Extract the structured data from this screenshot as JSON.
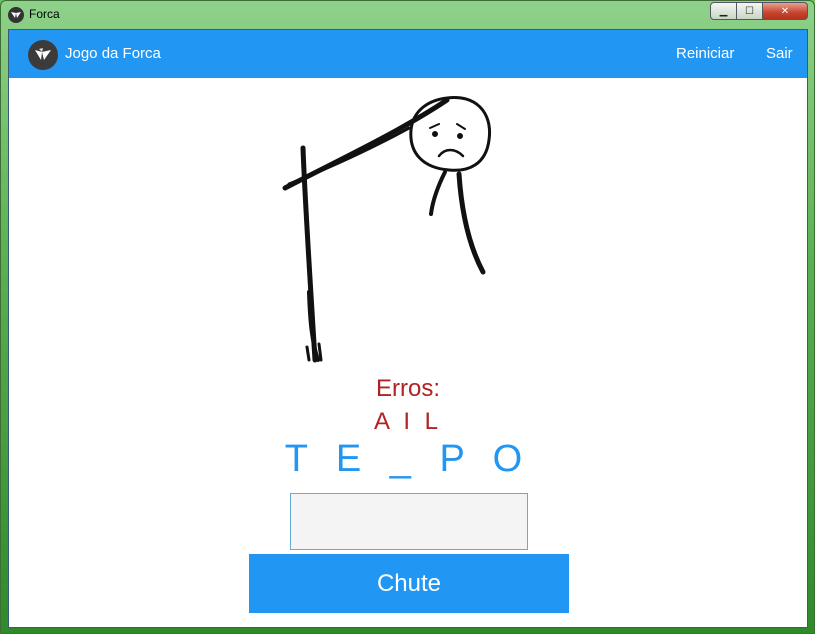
{
  "window": {
    "title": "Forca",
    "minimize_label": "▁",
    "maximize_label": "☐",
    "close_label": "✕"
  },
  "appbar": {
    "title": "Jogo da Forca",
    "restart_label": "Reiniciar",
    "exit_label": "Sair",
    "logo_icon": "kivy-logo-icon"
  },
  "game": {
    "errors_label": "Erros:",
    "wrong_letters": "A I L",
    "word_display": "T E _ P O",
    "guess_value": "",
    "guess_button_label": "Chute"
  },
  "colors": {
    "accent": "#2196f3",
    "error": "#b22222"
  }
}
